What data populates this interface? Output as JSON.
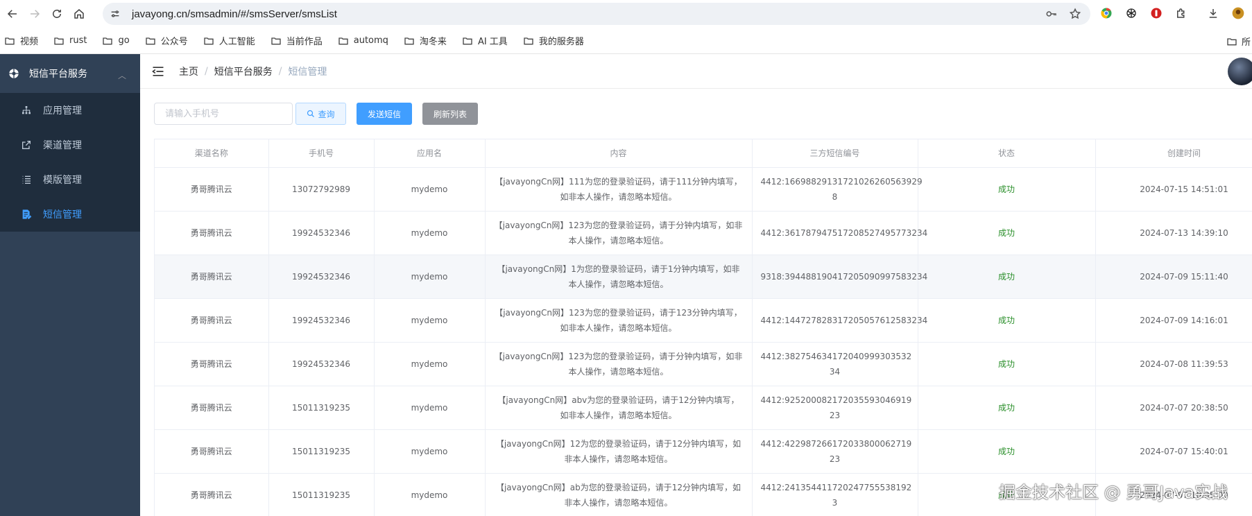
{
  "browser": {
    "url": "javayong.cn/smsadmin/#/smsServer/smsList",
    "bookmarks": [
      "视频",
      "rust",
      "go",
      "公众号",
      "人工智能",
      "当前作品",
      "automq",
      "淘冬来",
      "AI 工具",
      "我的服务器"
    ],
    "bookmark_overflow": "所"
  },
  "sidebar": {
    "header": "短信平台服务",
    "items": [
      {
        "label": "应用管理",
        "icon": "sitemap-icon"
      },
      {
        "label": "渠道管理",
        "icon": "external-link-icon"
      },
      {
        "label": "模版管理",
        "icon": "list-icon"
      },
      {
        "label": "短信管理",
        "icon": "document-edit-icon",
        "active": true
      }
    ]
  },
  "breadcrumb": [
    "主页",
    "短信平台服务",
    "短信管理"
  ],
  "toolbar": {
    "phone_placeholder": "请输入手机号",
    "query_label": "查询",
    "send_label": "发送短信",
    "refresh_label": "刷新列表"
  },
  "table": {
    "headers": [
      "渠道名称",
      "手机号",
      "应用名",
      "内容",
      "三方短信编号",
      "状态",
      "创建时间"
    ],
    "rows": [
      [
        "勇哥腾讯云",
        "13072792989",
        "mydemo",
        "【javayongCn网】111为您的登录验证码，请于111分钟内填写，如非本人操作，请忽略本短信。",
        "4412:16698829131721026260563929 8",
        "成功",
        "2024-07-15 14:51:01"
      ],
      [
        "勇哥腾讯云",
        "19924532346",
        "mydemo",
        "【javayongCn网】123为您的登录验证码，请于分钟内填写，如非本人操作，请忽略本短信。",
        "4412:361787947517208527495773234",
        "成功",
        "2024-07-13 14:39:10"
      ],
      [
        "勇哥腾讯云",
        "19924532346",
        "mydemo",
        "【javayongCn网】1为您的登录验证码，请于1分钟内填写，如非本人操作，请忽略本短信。",
        "9318:394488190417205090997583234",
        "成功",
        "2024-07-09 15:11:40"
      ],
      [
        "勇哥腾讯云",
        "19924532346",
        "mydemo",
        "【javayongCn网】123为您的登录验证码，请于123分钟内填写，如非本人操作，请忽略本短信。",
        "4412:144727828317205057612583234",
        "成功",
        "2024-07-09 14:16:01"
      ],
      [
        "勇哥腾讯云",
        "19924532346",
        "mydemo",
        "【javayongCn网】123为您的登录验证码，请于分钟内填写，如非本人操作，请忽略本短信。",
        "4412:382754634172040999303532 34",
        "成功",
        "2024-07-08 11:39:53"
      ],
      [
        "勇哥腾讯云",
        "15011319235",
        "mydemo",
        "【javayongCn网】abv为您的登录验证码，请于12分钟内填写，如非本人操作，请忽略本短信。",
        "4412:925200082172035593046919 23",
        "成功",
        "2024-07-07 20:38:50"
      ],
      [
        "勇哥腾讯云",
        "15011319235",
        "mydemo",
        "【javayongCn网】12为您的登录验证码，请于12分钟内填写，如非本人操作，请忽略本短信。",
        "4412:422987266172033800062719 23",
        "成功",
        "2024-07-07 15:40:01"
      ],
      [
        "勇哥腾讯云",
        "15011319235",
        "mydemo",
        "【javayongCn网】ab为您的登录验证码，请于12分钟内填写，如非本人操作，请忽略本短信。",
        "4412:241354411720247755538192 3",
        "成功",
        "2024-07-07 10:35:00"
      ]
    ]
  },
  "watermark": "掘金技术社区 @ 勇哥Java实战"
}
